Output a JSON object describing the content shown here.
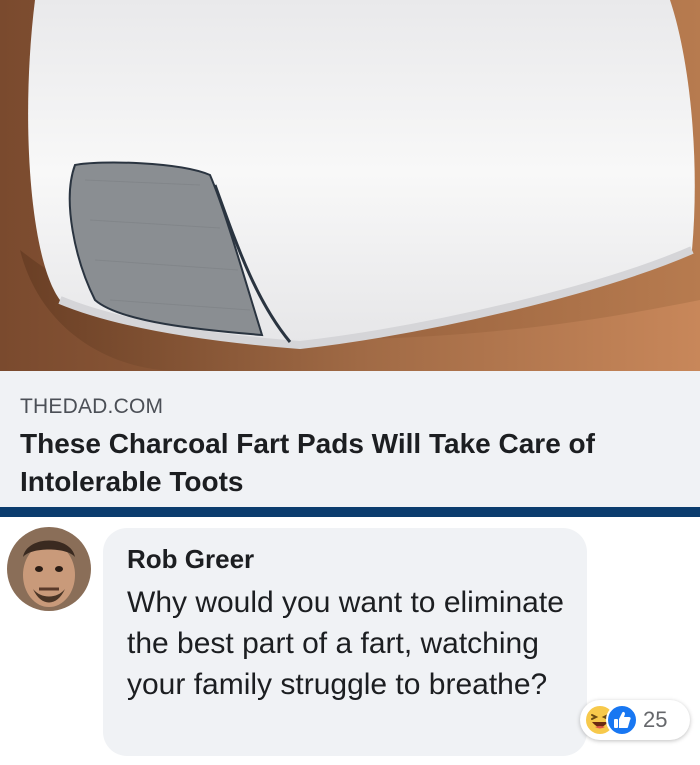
{
  "link_preview": {
    "domain": "THEDAD.COM",
    "title": "These Charcoal Fart Pads Will Take Care of Intolerable Toots"
  },
  "comment": {
    "author": "Rob Greer",
    "text": "Why would you want to eliminate the best part of a fart, watching your family struggle to breathe?",
    "reaction_count": "25",
    "reaction_icons": [
      "haha-icon",
      "like-icon"
    ]
  },
  "colors": {
    "link_bar": "#0b3c6e",
    "bubble_bg": "#f0f2f5",
    "like_blue": "#1877f2",
    "haha_yellow": "#f7c94b"
  }
}
